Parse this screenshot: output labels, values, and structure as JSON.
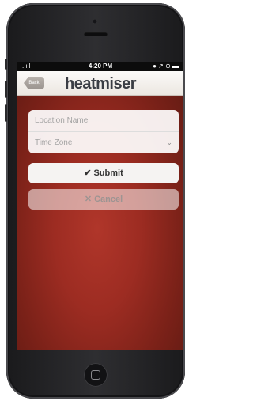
{
  "status_bar": {
    "signal": ".ııll",
    "time": "4:20 PM",
    "icons": "● ↗ ⊕ ▬"
  },
  "nav_bar": {
    "back_label": "Back",
    "logo_text": "heatmiser"
  },
  "form": {
    "location_placeholder": "Location Name",
    "timezone_placeholder": "Time Zone",
    "chevron": "⌄"
  },
  "buttons": {
    "submit_icon": "✔",
    "submit_label": "Submit",
    "cancel_icon": "✕",
    "cancel_label": "Cancel"
  },
  "colors": {
    "screen_bg": "#9d2c22",
    "navbar_bg": "#f4f0ec",
    "logo": "#3a3d44"
  }
}
